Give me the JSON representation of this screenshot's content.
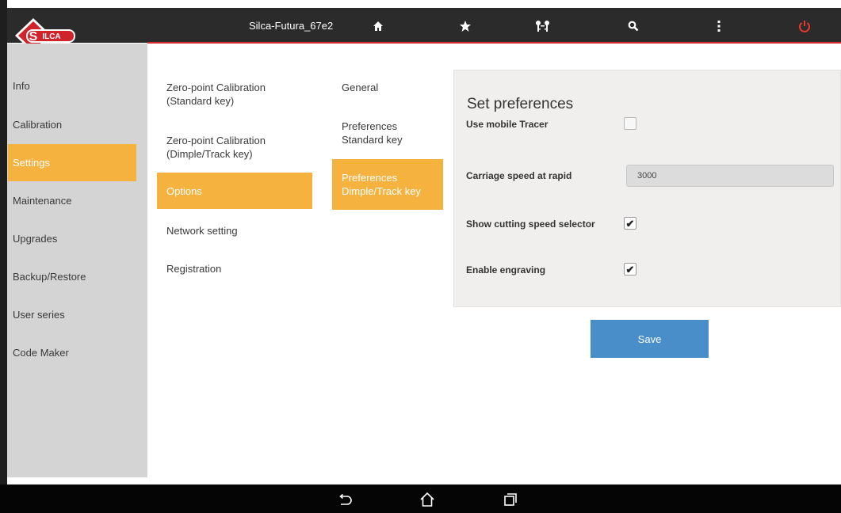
{
  "topbar": {
    "device_name": "Silca-Futura_67e2",
    "icons": [
      "silca-logo",
      "home-icon",
      "star-icon",
      "keys-icon",
      "search-icon",
      "more-icon",
      "power-icon"
    ],
    "accent_color": "#d92b2b",
    "power_color": "#e83a2e"
  },
  "sidebar": {
    "items": [
      {
        "label": "Info"
      },
      {
        "label": "Calibration"
      },
      {
        "label": "Settings"
      },
      {
        "label": "Maintenance"
      },
      {
        "label": "Upgrades"
      },
      {
        "label": "Backup/Restore"
      },
      {
        "label": "User series"
      },
      {
        "label": "Code Maker"
      }
    ],
    "active": "Settings",
    "active_color": "#f6b23e"
  },
  "settings_menu": {
    "items": [
      {
        "line1": "Zero-point Calibration",
        "line2": "(Standard key)"
      },
      {
        "line1": "Zero-point Calibration",
        "line2": "(Dimple/Track key)"
      },
      {
        "line1": "Options",
        "line2": ""
      },
      {
        "line1": "Network setting",
        "line2": ""
      },
      {
        "line1": "Registration",
        "line2": ""
      }
    ],
    "active": "Options"
  },
  "options_menu": {
    "items": [
      {
        "line1": "General",
        "line2": ""
      },
      {
        "line1": "Preferences",
        "line2": "Standard key"
      },
      {
        "line1": "Preferences",
        "line2": "Dimple/Track key"
      }
    ],
    "active": "Preferences Dimple/Track key"
  },
  "preferences": {
    "title": "Set preferences",
    "use_mobile_tracer": {
      "label": "Use mobile Tracer",
      "checked": false
    },
    "carriage_speed": {
      "label": "Carriage speed at rapid",
      "value": "3000"
    },
    "show_cutting_speed": {
      "label": "Show cutting speed selector",
      "checked": true
    },
    "enable_engraving": {
      "label": "Enable engraving",
      "checked": true
    },
    "save_label": "Save",
    "save_color": "#4a8ec9"
  },
  "android_nav": {
    "icons": [
      "back-icon",
      "home-nav-icon",
      "recents-icon"
    ]
  }
}
